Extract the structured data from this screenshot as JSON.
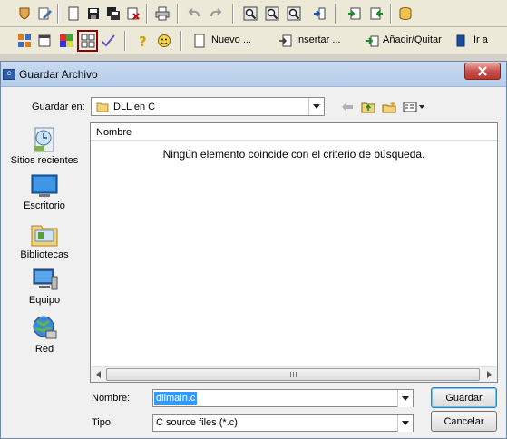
{
  "app_toolbar": {
    "new_label": "Nuevo ...",
    "insert_label": "Insertar ...",
    "add_remove_label": "Añadir/Quitar",
    "goto_label": "Ir a"
  },
  "dialog": {
    "title": "Guardar Archivo",
    "save_in": {
      "label": "Guardar en:",
      "value": "DLL en C"
    },
    "places": [
      {
        "label": "Sitios recientes",
        "icon": "recent-places-icon"
      },
      {
        "label": "Escritorio",
        "icon": "desktop-icon"
      },
      {
        "label": "Bibliotecas",
        "icon": "libraries-icon"
      },
      {
        "label": "Equipo",
        "icon": "computer-icon"
      },
      {
        "label": "Red",
        "icon": "network-icon"
      }
    ],
    "file_list": {
      "column_name": "Nombre",
      "empty_message": "Ningún elemento coincide con el criterio de búsqueda."
    },
    "filename": {
      "label": "Nombre:",
      "value": "dllmain.c"
    },
    "filetype": {
      "label": "Tipo:",
      "value": "C source files (*.c)"
    },
    "save_button": "Guardar",
    "cancel_button": "Cancelar"
  },
  "colors": {
    "selection": "#3399ff",
    "close_button": "#c75050",
    "title_bar": "#b5cde9",
    "highlight_border": "#8b0000"
  }
}
